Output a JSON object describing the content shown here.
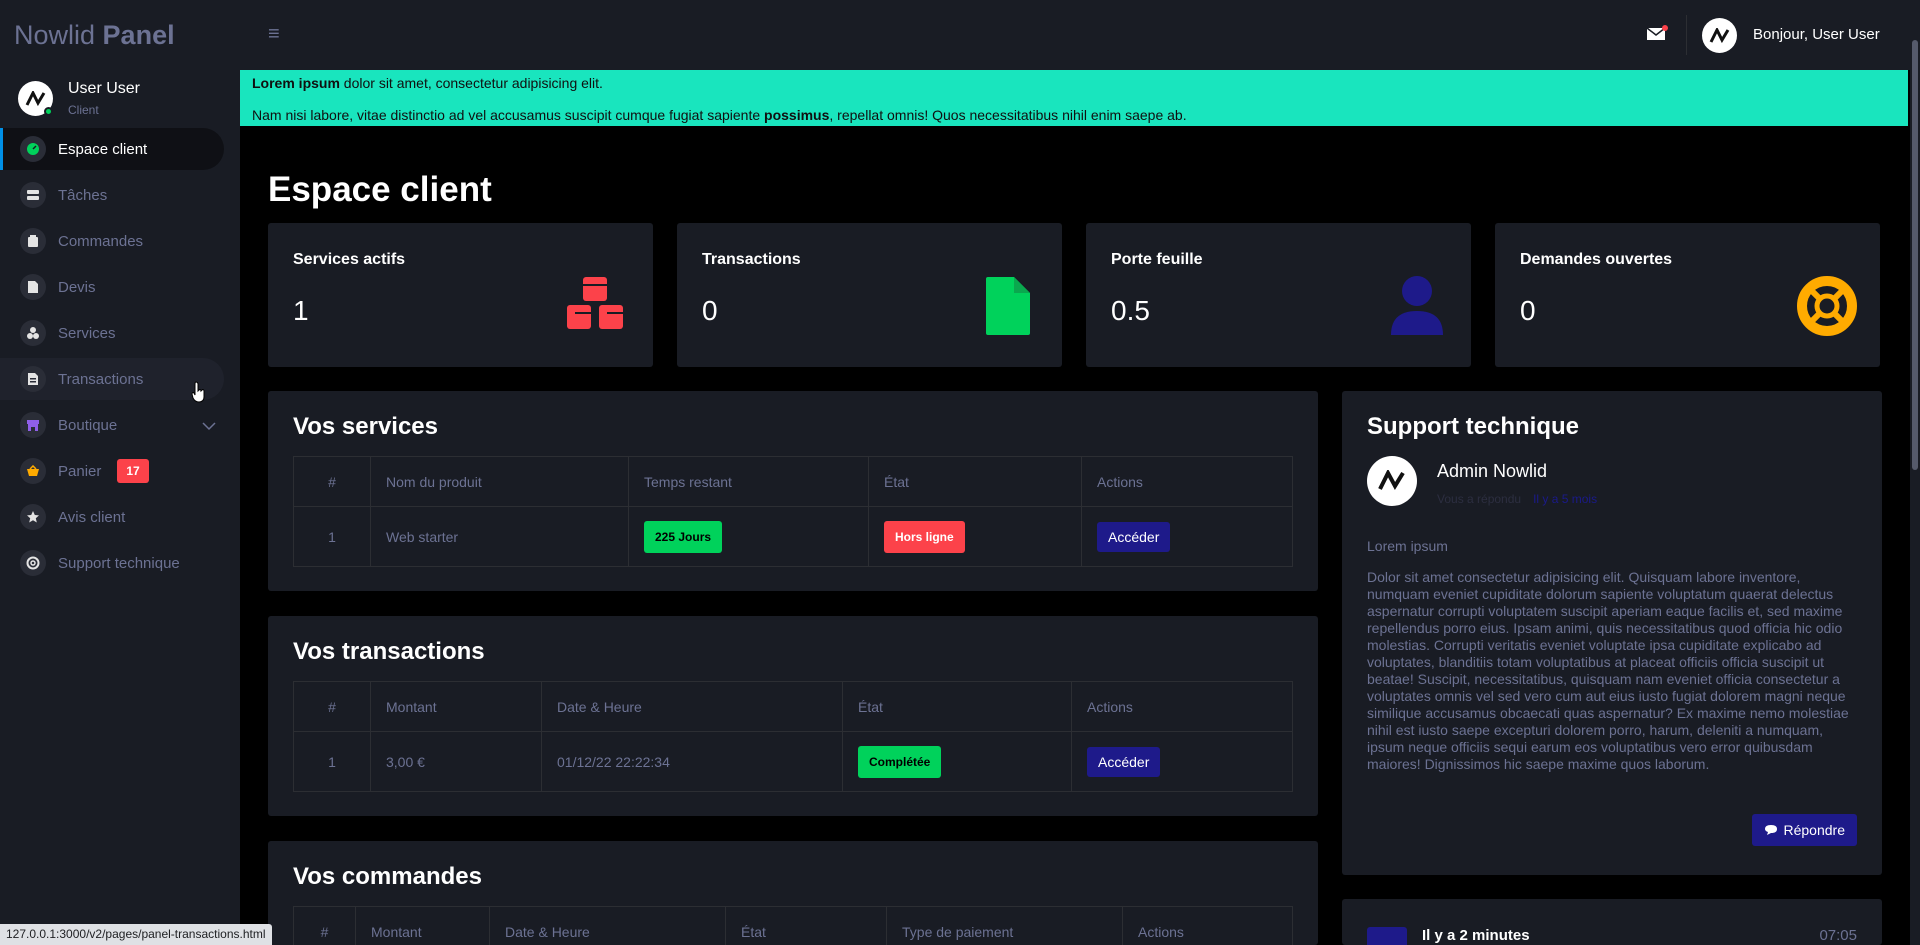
{
  "brand": {
    "prefix": "Nowlid",
    "suffix": "Panel"
  },
  "profile": {
    "name": "User User",
    "role": "Client"
  },
  "sidebar": {
    "items": [
      {
        "label": "Espace client",
        "icon": "speedometer-icon"
      },
      {
        "label": "Tâches",
        "icon": "tasks-icon"
      },
      {
        "label": "Commandes",
        "icon": "cart-icon"
      },
      {
        "label": "Devis",
        "icon": "file-icon"
      },
      {
        "label": "Services",
        "icon": "cubes-icon"
      },
      {
        "label": "Transactions",
        "icon": "receipt-icon"
      },
      {
        "label": "Boutique",
        "icon": "store-icon"
      },
      {
        "label": "Panier",
        "icon": "basket-icon",
        "badge": "17"
      },
      {
        "label": "Avis client",
        "icon": "star-icon"
      },
      {
        "label": "Support technique",
        "icon": "lifebuoy-icon"
      }
    ]
  },
  "topbar": {
    "greeting": "Bonjour, User User"
  },
  "alert": {
    "line1_bold": "Lorem ipsum",
    "line1_rest": " dolor sit amet, consectetur adipisicing elit.",
    "line2_a": "Nam nisi labore, vitae distinctio ad vel accusamus suscipit cumque fugiat sapiente ",
    "line2_bold": "possimus",
    "line2_b": ", repellat omnis! Quos necessitatibus nihil enim saepe ab."
  },
  "page": {
    "title": "Espace client"
  },
  "stats": [
    {
      "label": "Services actifs",
      "value": "1",
      "color": "#fc424a"
    },
    {
      "label": "Transactions",
      "value": "0",
      "color": "#00d25b"
    },
    {
      "label": "Porte feuille",
      "value": "0.5",
      "color": "#1e1a8a"
    },
    {
      "label": "Demandes ouvertes",
      "value": "0",
      "color": "#ffab00"
    }
  ],
  "services": {
    "title": "Vos services",
    "headers": [
      "#",
      "Nom du produit",
      "Temps restant",
      "État",
      "Actions"
    ],
    "row": {
      "id": "1",
      "name": "Web starter",
      "remaining": "225 Jours",
      "state": "Hors ligne",
      "action": "Accéder"
    }
  },
  "transactions": {
    "title": "Vos transactions",
    "headers": [
      "#",
      "Montant",
      "Date & Heure",
      "État",
      "Actions"
    ],
    "row": {
      "id": "1",
      "amount": "3,00 €",
      "date": "01/12/22 22:22:34",
      "state": "Complétée",
      "action": "Accéder"
    }
  },
  "orders": {
    "title": "Vos commandes",
    "headers": [
      "#",
      "Montant",
      "Date & Heure",
      "État",
      "Type de paiement",
      "Actions"
    ]
  },
  "support": {
    "title": "Support technique",
    "author": "Admin Nowlid",
    "replied": "Vous a répondu",
    "replied_time": "Il y a 5 mois",
    "subject": "Lorem ipsum",
    "body": "Dolor sit amet consectetur adipisicing elit. Quisquam labore inventore, numquam eveniet cupiditate dolorum sapiente voluptatum quaerat delectus aspernatur corrupti voluptatem suscipit aperiam eaque facilis et, sed maxime repellendus porro eius. Ipsam animi, quis necessitatibus quod officia hic odio molestias. Corrupti veritatis eveniet voluptate ipsa cupiditate explicabo ad voluptates, blanditiis totam voluptatibus at placeat officiis officia suscipit ut beatae! Suscipit, necessitatibus, quisquam nam eveniet officia consectetur a voluptates omnis vel sed vero cum aut eius iusto fugiat dolorem magni neque similique accusamus obcaecati quas aspernatur? Ex maxime nemo molestiae nihil est iusto saepe excepturi dolorem porro, harum, deleniti a numquam, ipsum neque officiis sequi earum eos voluptatibus vero error quibusdam maiores! Dignissimos hic saepe maxime quos laborum.",
    "reply_label": "Répondre"
  },
  "activity": {
    "title": "Il y a 2 minutes",
    "time": "07:05"
  },
  "statusbar": {
    "url": "127.0.0.1:3000/v2/pages/panel-transactions.html"
  }
}
